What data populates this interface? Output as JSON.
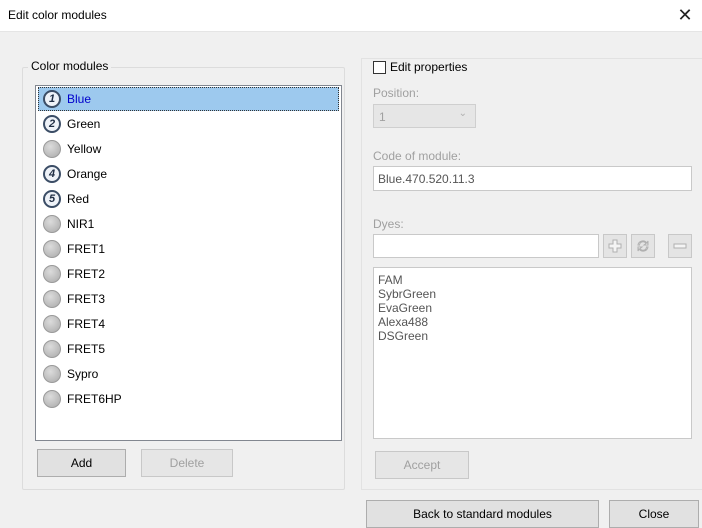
{
  "window": {
    "title": "Edit color modules",
    "close_glyph": "✕"
  },
  "modules_group": {
    "label": "Color modules"
  },
  "modules": [
    {
      "badge": "1",
      "label": "Blue",
      "selected": true
    },
    {
      "badge": "2",
      "label": "Green"
    },
    {
      "badge": "",
      "label": "Yellow"
    },
    {
      "badge": "4",
      "label": "Orange"
    },
    {
      "badge": "5",
      "label": "Red"
    },
    {
      "badge": "",
      "label": "NIR1"
    },
    {
      "badge": "",
      "label": "FRET1"
    },
    {
      "badge": "",
      "label": "FRET2"
    },
    {
      "badge": "",
      "label": "FRET3"
    },
    {
      "badge": "",
      "label": "FRET4"
    },
    {
      "badge": "",
      "label": "FRET5"
    },
    {
      "badge": "",
      "label": "Sypro"
    },
    {
      "badge": "",
      "label": "FRET6HP"
    }
  ],
  "buttons": {
    "add": "Add",
    "delete": "Delete",
    "accept": "Accept",
    "back": "Back to standard modules",
    "close": "Close"
  },
  "properties": {
    "edit_checkbox_label": "Edit properties",
    "edit_checked": false,
    "position_label": "Position:",
    "position_value": "1",
    "code_label": "Code of module:",
    "code_value": "Blue.470.520.11.3",
    "dyes_label": "Dyes:",
    "dye_input_value": "",
    "dyes": [
      "FAM",
      "SybrGreen",
      "EvaGreen",
      "Alexa488",
      "DSGreen"
    ]
  },
  "colors": {
    "selection": "#9dc9ee",
    "selected_text": "#0000cc",
    "disabled_text": "#a0a0a0"
  }
}
